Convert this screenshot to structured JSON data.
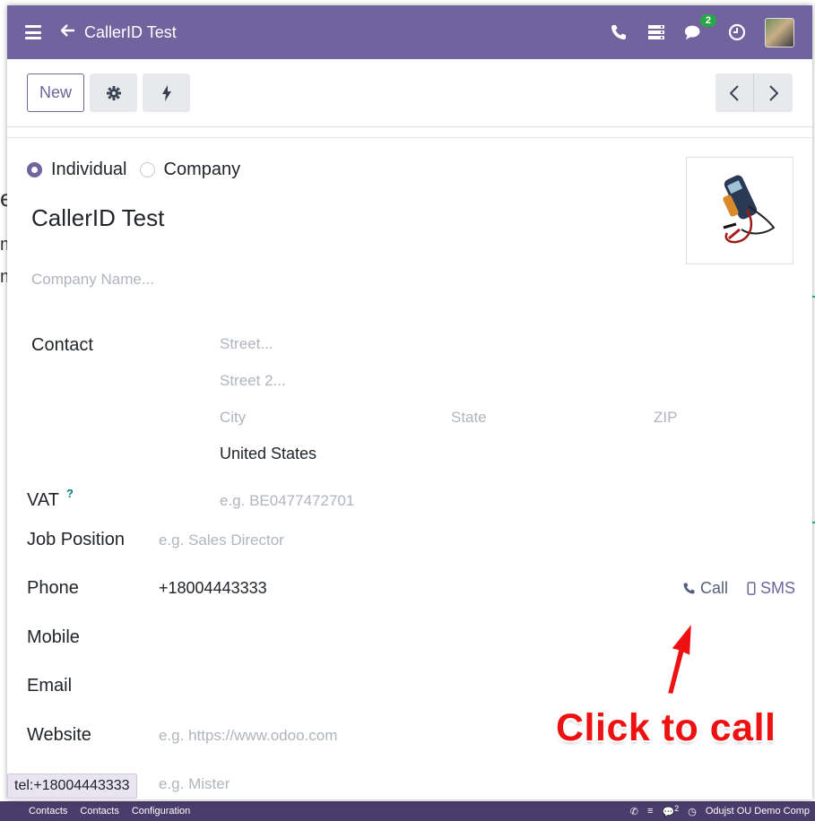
{
  "app": {
    "breadcrumb_title": "CallerID Test",
    "chat_badge": "2",
    "brand_color": "#71639e"
  },
  "toolbar": {
    "new_label": "New"
  },
  "form": {
    "radio_individual": "Individual",
    "radio_company": "Company",
    "selected_type": "Individual",
    "contact_name": "CallerID Test",
    "company_placeholder": "Company Name...",
    "contact_label": "Contact",
    "street_placeholder": "Street...",
    "street2_placeholder": "Street 2...",
    "city_placeholder": "City",
    "state_placeholder": "State",
    "zip_placeholder": "ZIP",
    "country": "United States",
    "vat_label": "VAT",
    "vat_help": "?",
    "vat_placeholder": "e.g. BE0477472701",
    "job_label": "Job Position",
    "job_placeholder": "e.g. Sales Director",
    "phone_label": "Phone",
    "phone_value": "+18004443333",
    "call_label": "Call",
    "sms_label": "SMS",
    "mobile_label": "Mobile",
    "email_label": "Email",
    "website_label": "Website",
    "website_placeholder": "e.g. https://www.odoo.com",
    "title_placeholder": "e.g. Mister"
  },
  "annotation": {
    "text": "Click to call"
  },
  "status_tooltip": "tel:+18004443333",
  "background_app": {
    "menu_items": [
      "Contacts",
      "Contacts",
      "Configuration"
    ],
    "badge": "2",
    "company": "Odujst OU Demo Comp"
  }
}
